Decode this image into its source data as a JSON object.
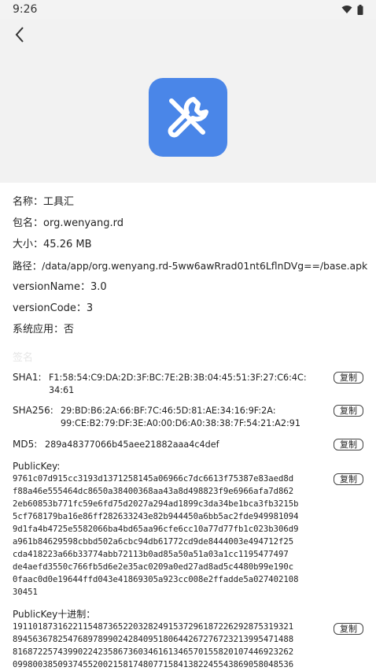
{
  "status": {
    "time": "9:26"
  },
  "app": {
    "name_label": "名称：",
    "name": "工具汇",
    "package_label": "包名：",
    "package": "org.wenyang.rd",
    "size_label": "大小：",
    "size": "45.26 MB",
    "path_label": "路径：",
    "path": "/data/app/org.wenyang.rd-5ww6awRrad01nt6LflnDVg==/base.apk",
    "version_name_label": "versionName：",
    "version_name": "3.0",
    "version_code_label": "versionCode：",
    "version_code": "3",
    "system_app_label": "系统应用：",
    "system_app": "否"
  },
  "signature": {
    "section_title": "签名",
    "copy_label": "复制",
    "sha1_label": "SHA1:",
    "sha1_line1": "F1:58:54:C9:DA:2D:3F:BC:7E:2B:3B:04:45:51:3F:27:C6:4C:",
    "sha1_line2": "34:61",
    "sha256_label": "SHA256:",
    "sha256_line1": "29:BD:B6:2A:66:BF:7C:46:5D:81:AE:34:16:9F:2A:",
    "sha256_line2": "99:CE:B2:79:DF:3E:A0:00:D6:A0:38:38:7F:54:21:A2:91",
    "md5_label": "MD5:",
    "md5": "289a48377066b45aee21882aaa4c4def",
    "publickey_label": "PublicKey:",
    "publickey_lines": [
      "9761c07d915cc3193d1371258145a06966c7dc6613f75387e83aed8d",
      "f88a46e555464dc8650a38400368aa43a8d498823f9e6966afa7d862",
      "2eb60853b771fc59e6fd75d2027a294ad1899c3da34be1bca3fb3215b",
      "5cf768179ba16e86ff282633243e82b944450a6bb5ac2fde949981094",
      "9d1fa4b4725e5582066ba4bd65aa96cfe6cc10a77d77fb1c023b306d9",
      "a961b84629598cbbd502a6cbc94db61772cd9de8444003e494712f25",
      "cda418223a66b33774abb72113b0ad85a50a51a03a1cc1195477497",
      "de4aefd3550c766fb5d6e2e35ac0209a0ed27ad8ad5c4480b99e190c",
      "0faac0d0e19644ffd043e41869305a923cc008e2ffadde5a027402108",
      "30451"
    ],
    "publickey_dec_label": "PublicKey十进制：",
    "publickey_dec_lines": [
      "19110187316221154873652203282491537296187226292875319321",
      "89456367825476897899024284095180644267276723213995471488",
      "81687225743990224235867360346161346570155820107446923262",
      "09980038509374552002158174807715841382245543869058048536"
    ]
  }
}
